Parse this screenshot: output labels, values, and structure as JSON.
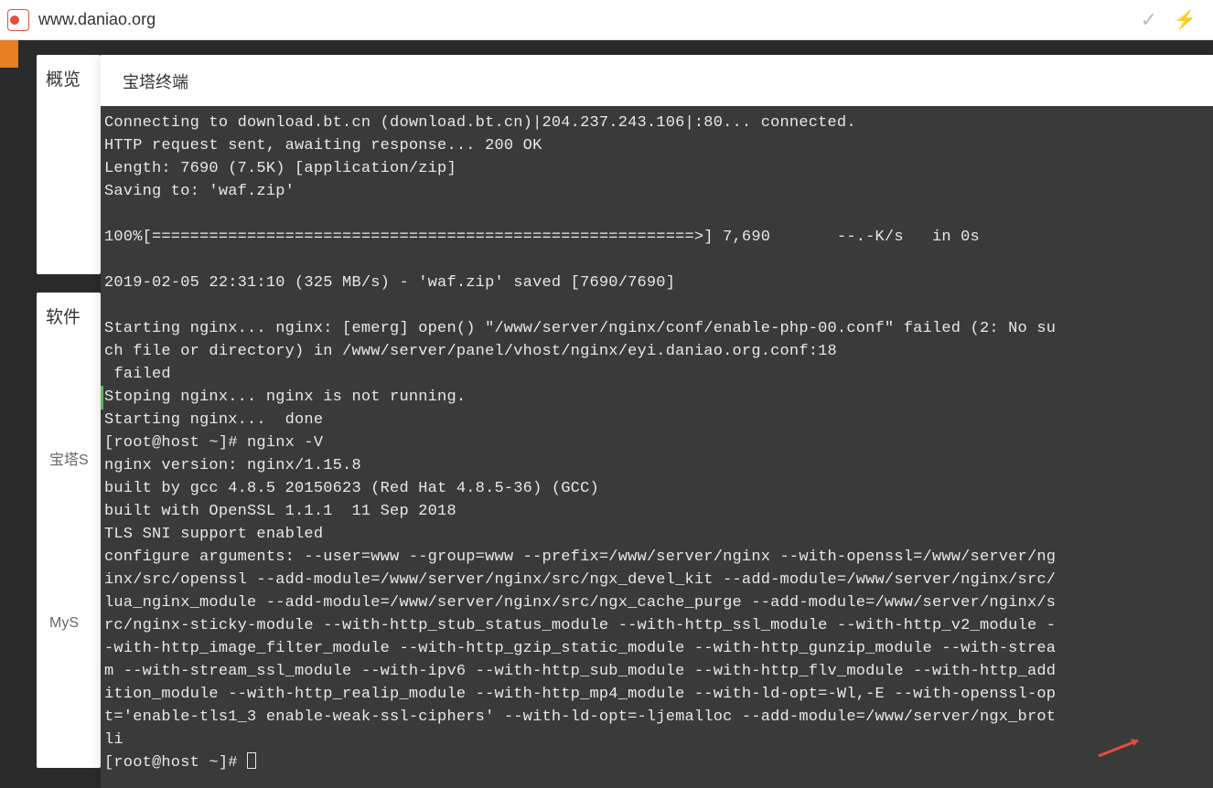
{
  "browser": {
    "url": "www.daniao.org"
  },
  "sidebar": {
    "overview_label": "概览",
    "software_label": "软件",
    "items": [
      "宝塔S",
      "MyS"
    ]
  },
  "modal": {
    "title": "宝塔终端"
  },
  "terminal": {
    "lines": [
      "Connecting to download.bt.cn (download.bt.cn)|204.237.243.106|:80... connected.",
      "HTTP request sent, awaiting response... 200 OK",
      "Length: 7690 (7.5K) [application/zip]",
      "Saving to: 'waf.zip'",
      "",
      "100%[=========================================================>] 7,690       --.-K/s   in 0s",
      "",
      "2019-02-05 22:31:10 (325 MB/s) - 'waf.zip' saved [7690/7690]",
      "",
      "Starting nginx... nginx: [emerg] open() \"/www/server/nginx/conf/enable-php-00.conf\" failed (2: No su",
      "ch file or directory) in /www/server/panel/vhost/nginx/eyi.daniao.org.conf:18",
      " failed",
      "Stoping nginx... nginx is not running.",
      "Starting nginx...  done",
      "[root@host ~]# nginx -V",
      "nginx version: nginx/1.15.8",
      "built by gcc 4.8.5 20150623 (Red Hat 4.8.5-36) (GCC)",
      "built with OpenSSL 1.1.1  11 Sep 2018",
      "TLS SNI support enabled",
      "configure arguments: --user=www --group=www --prefix=/www/server/nginx --with-openssl=/www/server/ng",
      "inx/src/openssl --add-module=/www/server/nginx/src/ngx_devel_kit --add-module=/www/server/nginx/src/",
      "lua_nginx_module --add-module=/www/server/nginx/src/ngx_cache_purge --add-module=/www/server/nginx/s",
      "rc/nginx-sticky-module --with-http_stub_status_module --with-http_ssl_module --with-http_v2_module -",
      "-with-http_image_filter_module --with-http_gzip_static_module --with-http_gunzip_module --with-strea",
      "m --with-stream_ssl_module --with-ipv6 --with-http_sub_module --with-http_flv_module --with-http_add",
      "ition_module --with-http_realip_module --with-http_mp4_module --with-ld-opt=-Wl,-E --with-openssl-op",
      "t='enable-tls1_3 enable-weak-ssl-ciphers' --with-ld-opt=-ljemalloc --add-module=/www/server/ngx_brot",
      "li"
    ],
    "prompt": "[root@host ~]# "
  }
}
